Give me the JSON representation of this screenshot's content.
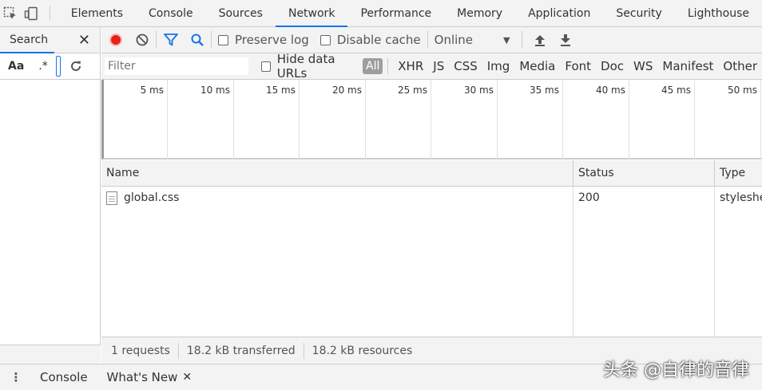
{
  "topbar": {
    "tabs": [
      "Elements",
      "Console",
      "Sources",
      "Network",
      "Performance",
      "Memory",
      "Application",
      "Security",
      "Lighthouse"
    ],
    "active_tab": "Network",
    "accent_color": "#1a73e8"
  },
  "search_panel": {
    "title": "Search",
    "close": "✕",
    "match_case": "Aa",
    "regex": ".*"
  },
  "network_toolbar": {
    "preserve_log": "Preserve log",
    "disable_cache": "Disable cache",
    "throttle": "Online",
    "record_color": "#e8201b"
  },
  "filter_bar": {
    "placeholder": "Filter",
    "hide_data_urls": "Hide data URLs",
    "all": "All",
    "types": [
      "XHR",
      "JS",
      "CSS",
      "Img",
      "Media",
      "Font",
      "Doc",
      "WS",
      "Manifest",
      "Other"
    ]
  },
  "timeline": {
    "ticks": [
      "5 ms",
      "10 ms",
      "15 ms",
      "20 ms",
      "25 ms",
      "30 ms",
      "35 ms",
      "40 ms",
      "45 ms",
      "50 ms"
    ]
  },
  "table": {
    "headers": {
      "name": "Name",
      "status": "Status",
      "type": "Type"
    },
    "rows": [
      {
        "name": "global.css",
        "status": "200",
        "type": "stylesheet"
      }
    ]
  },
  "summary": {
    "requests": "1 requests",
    "transferred": "18.2 kB transferred",
    "resources": "18.2 kB resources"
  },
  "drawer": {
    "tabs": [
      "Console",
      "What's New"
    ],
    "close": "✕"
  },
  "watermark": "头条 @自律的音律"
}
